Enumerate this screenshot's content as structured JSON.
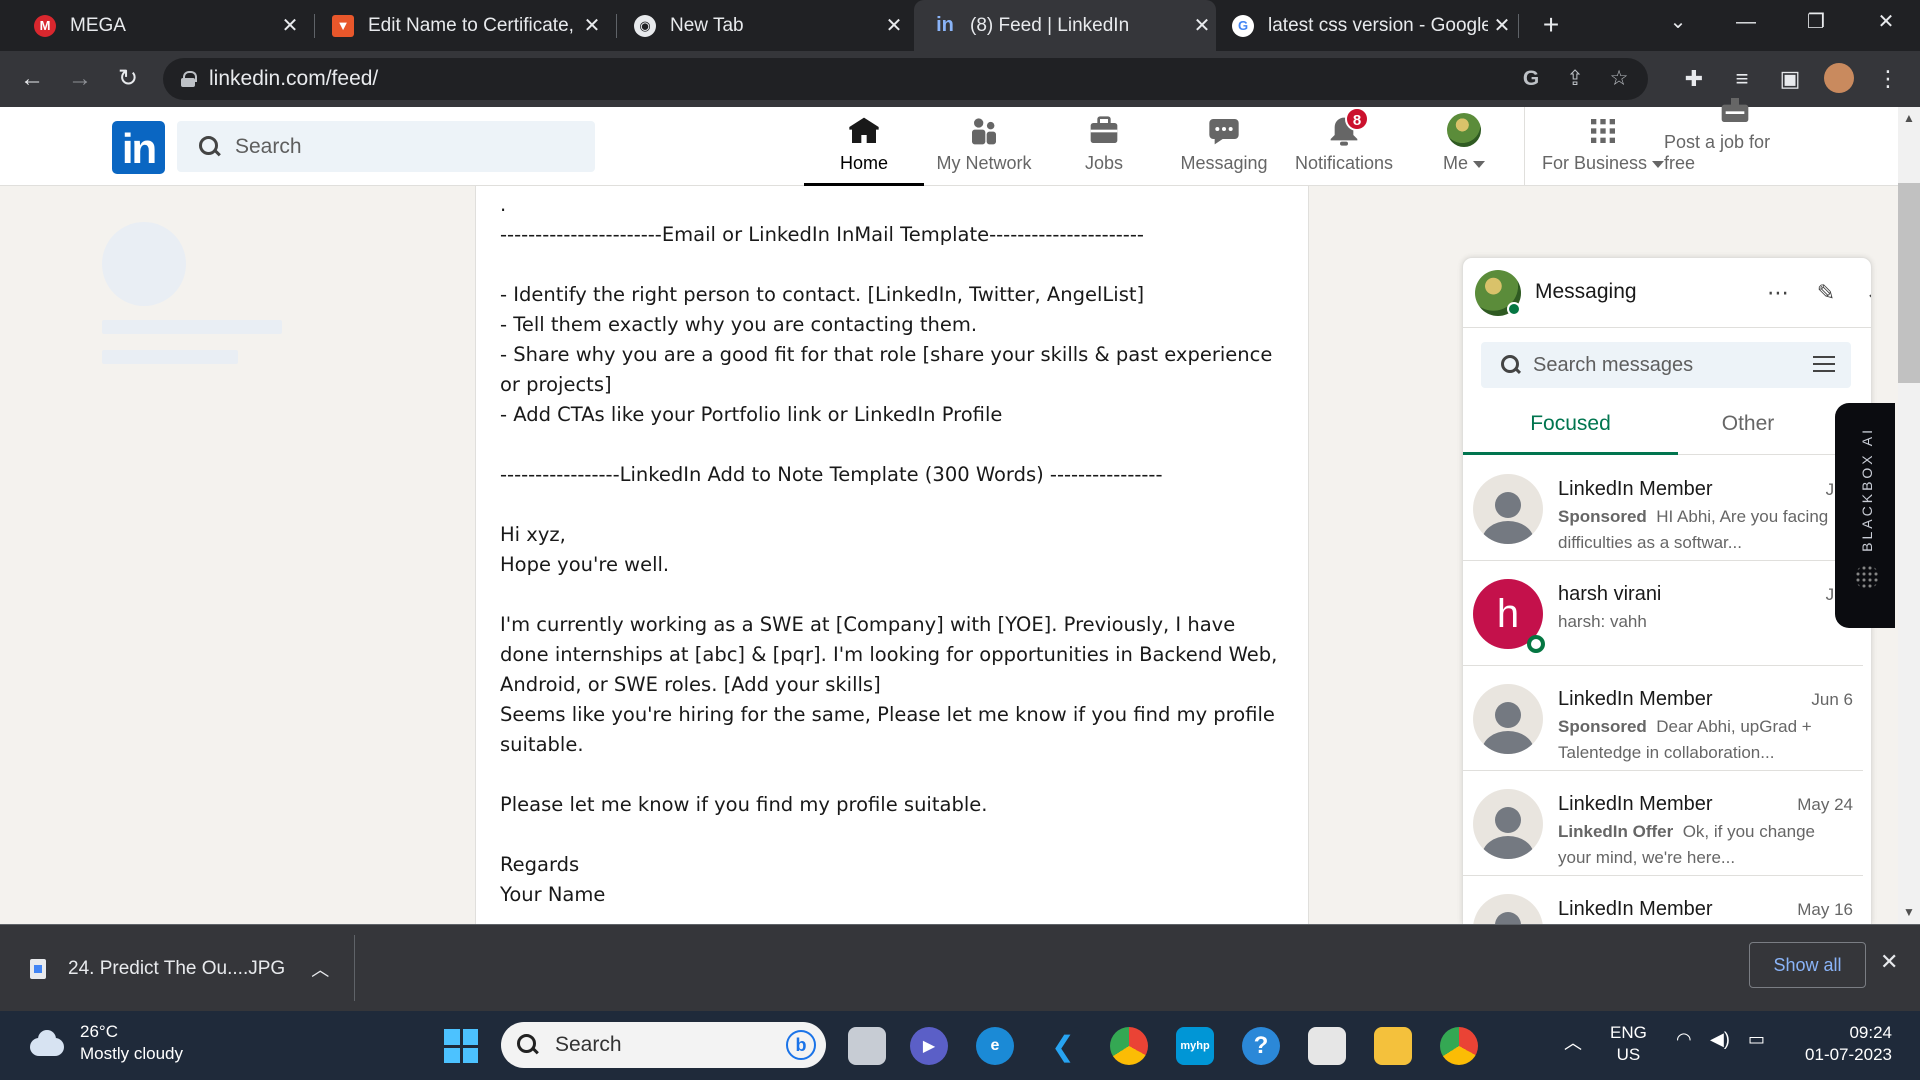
{
  "browser": {
    "tabs": [
      {
        "title": "MEGA",
        "icon": "mega-icon",
        "active": false
      },
      {
        "title": "Edit Name to Certificate, e",
        "icon": "edit-certificate-icon",
        "active": false
      },
      {
        "title": "New Tab",
        "icon": "chrome-icon",
        "active": false
      },
      {
        "title": "(8) Feed | LinkedIn",
        "icon": "linkedin-icon",
        "active": true
      },
      {
        "title": "latest css version - Google",
        "icon": "google-icon",
        "active": false
      }
    ],
    "url": "linkedin.com/feed/"
  },
  "linkedin": {
    "logo": "in",
    "search_placeholder": "Search",
    "nav": [
      {
        "label": "Home",
        "icon": "home-icon",
        "active": true
      },
      {
        "label": "My Network",
        "icon": "network-icon"
      },
      {
        "label": "Jobs",
        "icon": "briefcase-icon"
      },
      {
        "label": "Messaging",
        "icon": "chat-icon"
      },
      {
        "label": "Notifications",
        "icon": "bell-icon",
        "badge": "8"
      },
      {
        "label": "Me",
        "icon": "avatar-icon"
      },
      {
        "label": "For Business",
        "icon": "grid-icon"
      },
      {
        "label": "Post a job for free",
        "icon": "post-job-icon"
      }
    ]
  },
  "post": {
    "text": ".\n-----------------------Email or LinkedIn InMail Template----------------------\n\n- Identify the right person to contact. [LinkedIn, Twitter, AngelList]\n- Tell them exactly why you are contacting them.\n- Share why you are a good fit for that role [share your skills & past experience or projects]\n- Add CTAs like your Portfolio link or LinkedIn Profile\n\n-----------------LinkedIn Add to Note Template (300 Words) ----------------\n\nHi xyz,\nHope you're well.\n\nI'm currently working as a SWE at [Company] with [YOE]. Previously, I have done internships at [abc] & [pqr]. I'm looking for opportunities in Backend Web, Android, or SWE roles. [Add your skills]\nSeems like you're hiring for the same, Please let me know if you find my profile suitable.\n\nPlease let me know if you find my profile suitable.\n\nRegards\nYour Name\n---------------------------------------------------------------------------------------"
  },
  "messaging": {
    "title": "Messaging",
    "search_placeholder": "Search messages",
    "tabs": [
      "Focused",
      "Other"
    ],
    "conversations": [
      {
        "name": "LinkedIn Member",
        "date": "Jun",
        "tag": "Sponsored",
        "preview": "HI Abhi, Are you facing difficulties as a softwar..."
      },
      {
        "name": "harsh virani",
        "date": "Jun",
        "tag": "",
        "preview": "harsh: vahh",
        "avatar_letter": "h"
      },
      {
        "name": "LinkedIn Member",
        "date": "Jun 6",
        "tag": "Sponsored",
        "preview": "Dear Abhi,  upGrad + Talentedge in collaboration..."
      },
      {
        "name": "LinkedIn Member",
        "date": "May 24",
        "tag": "LinkedIn Offer",
        "preview": "Ok, if you change your mind, we're here..."
      },
      {
        "name": "LinkedIn Member",
        "date": "May 16",
        "tag": "",
        "preview": ""
      }
    ],
    "blackbox_label": "BLACKBOX AI"
  },
  "downloads": {
    "file": "24. Predict The Ou....JPG",
    "show_all": "Show all"
  },
  "taskbar": {
    "temperature": "26°C",
    "condition": "Mostly cloudy",
    "search": "Search",
    "lang": "ENG",
    "region": "US",
    "time": "09:24",
    "date": "01-07-2023"
  }
}
